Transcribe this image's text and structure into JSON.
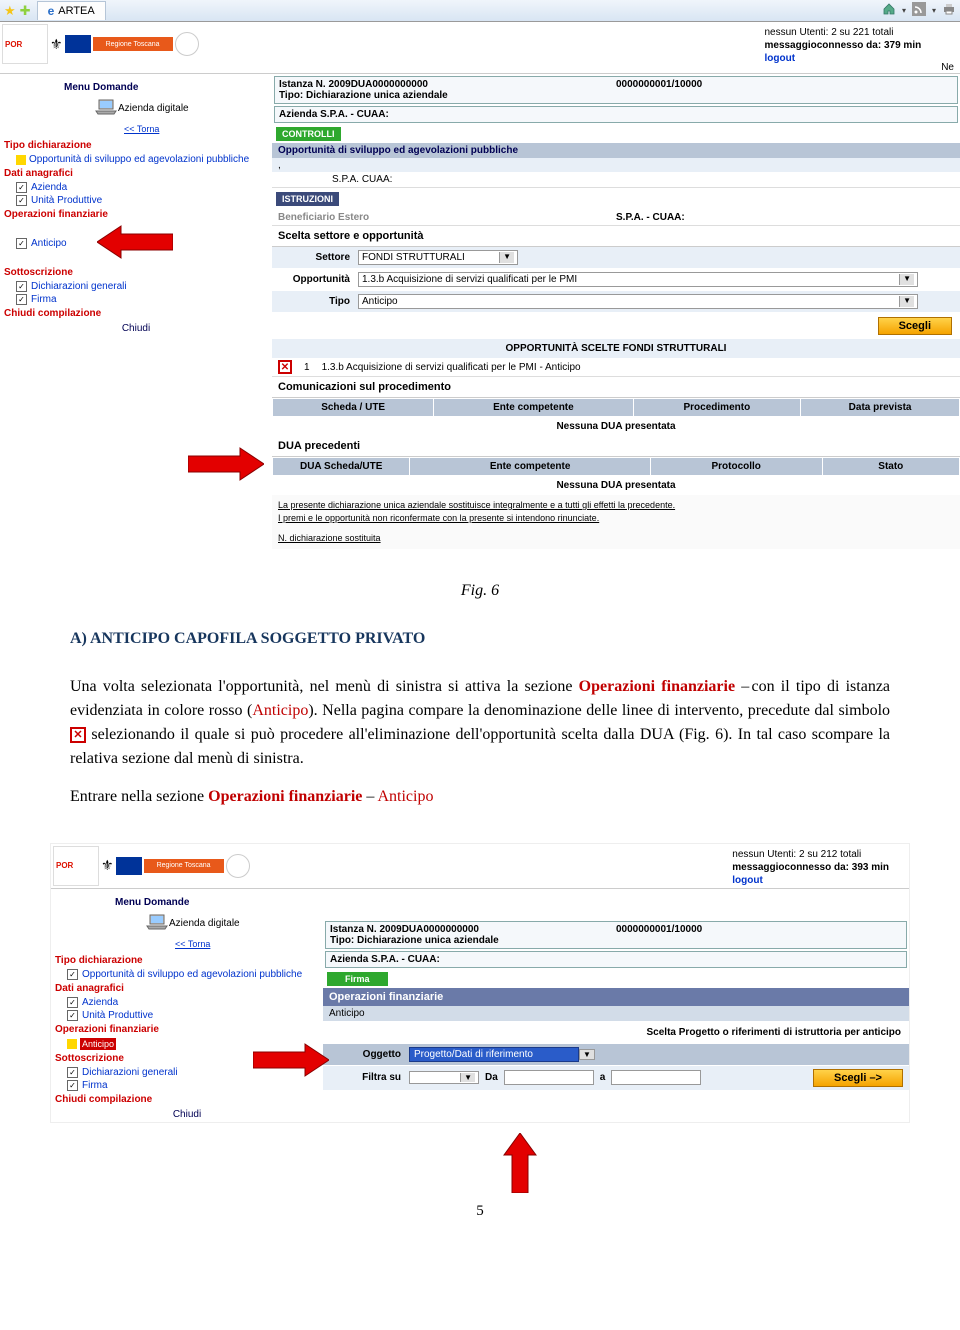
{
  "ie": {
    "tab_title": "ARTEA",
    "dropdown": "▾"
  },
  "header_status_1": "nessun    Utenti: 2 su 221 totali",
  "header_status_1b": "messaggioconnesso da: 379 min",
  "header_status_2": "nessun    Utenti: 2 su 212 totali",
  "header_status_2b": "messaggioconnesso da: 393 min",
  "logout": "logout",
  "ne": "Ne",
  "por_logo": "POR",
  "orange_bar": "Regione Toscana",
  "sidebar": {
    "menu_h": "Menu Domande",
    "azienda_digitale": "Azienda digitale",
    "torna": "<< Torna",
    "tipo_dichiarazione": "Tipo dichiarazione",
    "opportunita": "Opportunità di sviluppo ed agevolazioni pubbliche",
    "dati_anagrafici": "Dati anagrafici",
    "azienda": "Azienda",
    "unita": "Unità Produttive",
    "op_fin": "Operazioni finanziarie",
    "anticipo": "Anticipo",
    "sottoscrizione": "Sottoscrizione",
    "dich_gen": "Dichiarazioni generali",
    "firma": "Firma",
    "chiudi_comp": "Chiudi compilazione",
    "chiudi": "Chiudi"
  },
  "content1": {
    "istanza": "Istanza N. 2009DUA0000000000",
    "tipo": "Tipo: Dichiarazione unica aziendale",
    "code": "0000000001/10000",
    "azienda_row": "Azienda          S.P.A. - CUAA:",
    "controlli": "CONTROLLI",
    "opp_heading": "Opportunità di sviluppo ed agevolazioni pubbliche",
    "spa_cuaa": "S.P.A. CUAA:",
    "istruzioni": "ISTRUZIONI",
    "benef": "Beneficiario Estero",
    "spa_cuaa2": "S.P.A. - CUAA:",
    "scelta_h": "Scelta settore e opportunità",
    "settore_l": "Settore",
    "settore_v": "FONDI STRUTTURALI",
    "opp_l": "Opportunità",
    "opp_v": "1.3.b Acquisizione di servizi qualificati per le PMI",
    "tipo_l": "Tipo",
    "tipo_v": "Anticipo",
    "scegli": "Scegli",
    "opp_scelte": "OPPORTUNITÀ SCELTE FONDI STRUTTURALI",
    "row1_num": "1",
    "row1_text": "1.3.b Acquisizione di servizi qualificati per le PMI - Anticipo",
    "comunicazioni": "Comunicazioni sul procedimento",
    "th_scheda": "Scheda / UTE",
    "th_ente": "Ente competente",
    "th_proc": "Procedimento",
    "th_data": "Data prevista",
    "nessuna": "Nessuna DUA presentata",
    "dua_prec": "DUA precedenti",
    "th_dua": "DUA Scheda/UTE",
    "th_proto": "Protocollo",
    "th_stato": "Stato",
    "note1": "La presente dichiarazione unica aziendale sostituisce integralmente e a tutti gli effetti la precedente.",
    "note2": "I premi e le opportunità non riconfermate con la presente si intendono rinunciate.",
    "note3": "N. dichiarazione sostituita"
  },
  "doc": {
    "fig": "Fig. 6",
    "heading": "A)  ANTICIPO CAPOFILA SOGGETTO PRIVATO",
    "p1_a": "Una volta selezionata l'opportunità, nel menù di sinistra si attiva la sezione ",
    "p1_op": "Operazioni finanziarie",
    "p1_b": " con il tipo di istanza evidenziata in colore rosso (",
    "p1_ant": "Anticipo",
    "p1_c": "). Nella pagina compare la denominazione delle linee di intervento, precedute dal simbolo ",
    "p1_d": " selezionando il quale si può procedere all'eliminazione dell'opportunità scelta dalla DUA (Fig. 6). In tal caso scompare la relativa sezione dal menù di sinistra.",
    "p2_a": "Entrare nella sezione ",
    "p2_op": "Operazioni finanziarie",
    "p2_b": " – ",
    "p2_ant": "Anticipo"
  },
  "content2": {
    "istanza": "Istanza N. 2009DUA0000000000",
    "tipo": "Tipo: Dichiarazione unica aziendale",
    "code": "0000000001/10000",
    "azienda_row": "Azienda          S.P.A. - CUAA:",
    "firma": "Firma",
    "op_fin_bar": "Operazioni finanziarie",
    "anticipo_tab": "Anticipo",
    "scelta_right": "Scelta Progetto o riferimenti di istruttoria per anticipo",
    "oggetto_l": "Oggetto",
    "oggetto_v": "Progetto/Dati di riferimento",
    "filtra_l": "Filtra su",
    "da_l": "Da",
    "a_l": "a",
    "scegli2": "Scegli –>"
  },
  "page_num": "5"
}
